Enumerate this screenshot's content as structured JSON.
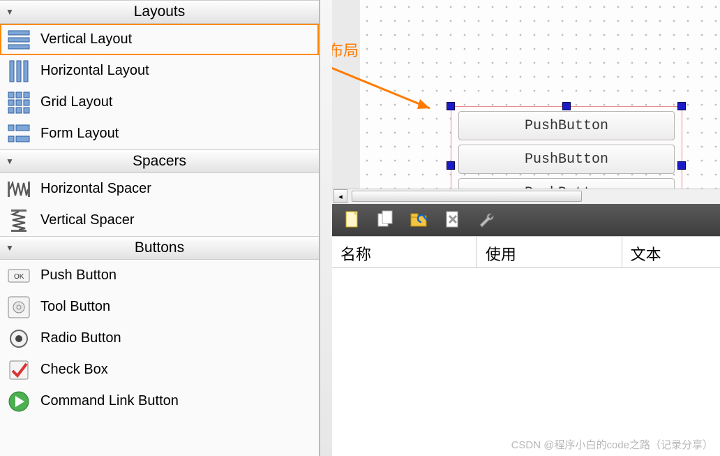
{
  "annotation": {
    "label": "垂直布局"
  },
  "widgetbox": {
    "groups": [
      {
        "title": "Layouts",
        "items": [
          {
            "id": "vertical-layout",
            "label": "Vertical Layout",
            "icon": "hstripes",
            "highlighted": true
          },
          {
            "id": "horizontal-layout",
            "label": "Horizontal Layout",
            "icon": "vstripes"
          },
          {
            "id": "grid-layout",
            "label": "Grid Layout",
            "icon": "grid"
          },
          {
            "id": "form-layout",
            "label": "Form Layout",
            "icon": "form"
          }
        ]
      },
      {
        "title": "Spacers",
        "items": [
          {
            "id": "hspacer",
            "label": "Horizontal Spacer",
            "icon": "hspring"
          },
          {
            "id": "vspacer",
            "label": "Vertical Spacer",
            "icon": "vspring"
          }
        ]
      },
      {
        "title": "Buttons",
        "items": [
          {
            "id": "push-button",
            "label": "Push Button",
            "icon": "okbtn"
          },
          {
            "id": "tool-button",
            "label": "Tool Button",
            "icon": "gear"
          },
          {
            "id": "radio-button",
            "label": "Radio Button",
            "icon": "radio"
          },
          {
            "id": "check-box",
            "label": "Check Box",
            "icon": "check"
          },
          {
            "id": "cmdlink-button",
            "label": "Command Link Button",
            "icon": "cmd"
          }
        ]
      }
    ]
  },
  "canvas": {
    "buttons": [
      {
        "text": "PushButton"
      },
      {
        "text": "PushButton"
      },
      {
        "text": "PushButton"
      }
    ]
  },
  "actionbar": {
    "icons": [
      "new-file-icon",
      "copy-file-icon",
      "folder-refresh-icon",
      "close-file-icon",
      "wrench-icon"
    ]
  },
  "property_headers": {
    "col1": "名称",
    "col2": "使用",
    "col3": "文本"
  },
  "watermark": "CSDN @程序小白的code之路（记录分享）"
}
